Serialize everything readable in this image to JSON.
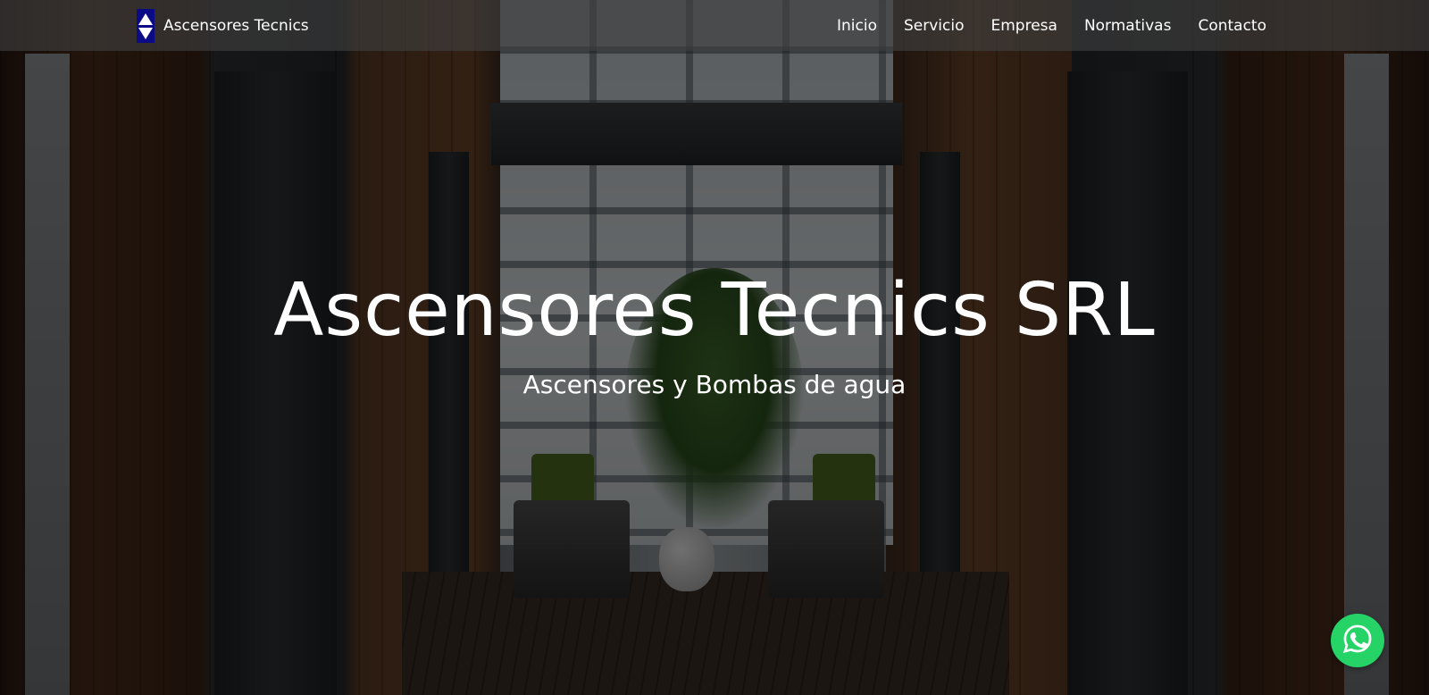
{
  "navbar": {
    "brand_name": "Ascensores Tecnics",
    "brand_logo_color": "#0b0b86",
    "links": [
      {
        "label": "Inicio"
      },
      {
        "label": "Servicio"
      },
      {
        "label": "Empresa"
      },
      {
        "label": "Normativas"
      },
      {
        "label": "Contacto"
      }
    ]
  },
  "hero": {
    "title": "Ascensores Tecnics SRL",
    "subtitle": "Ascensores y Bombas de agua",
    "background": "elevator-lobby-photo"
  },
  "whatsapp": {
    "icon": "whatsapp-icon",
    "color": "#25d366"
  }
}
